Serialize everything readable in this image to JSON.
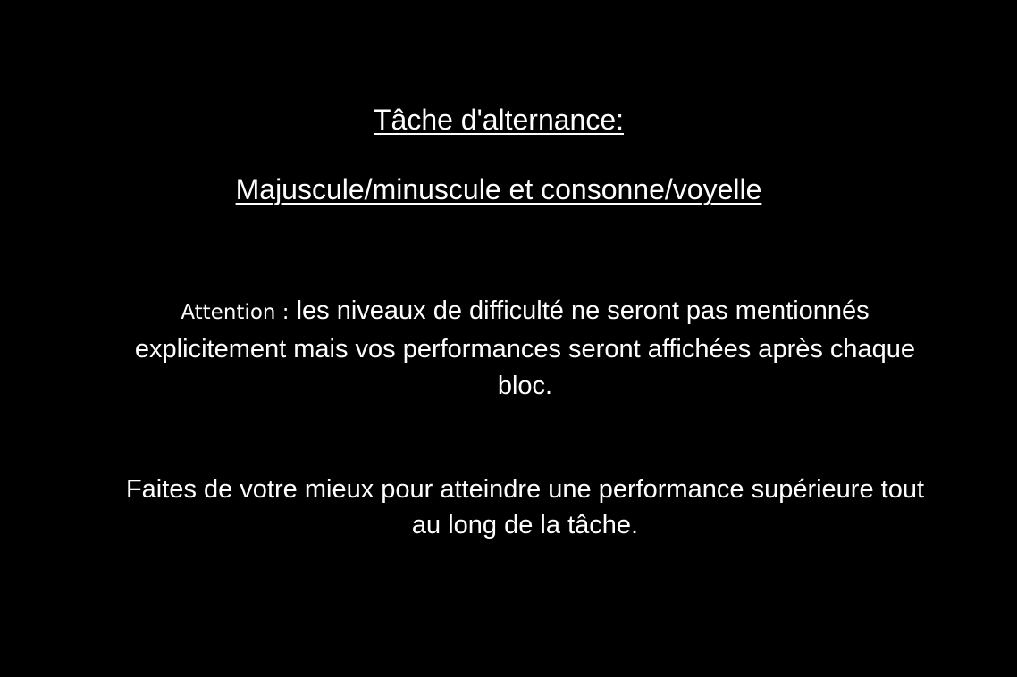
{
  "instructions": {
    "title": "Tâche d'alternance:",
    "subtitle": "Majuscule/minuscule et consonne/voyelle",
    "attention_label": "Attention :",
    "attention_text": " les niveaux de difficulté ne seront pas mentionnés explicitement mais vos performances seront affichées après chaque bloc.",
    "encouragement": "Faites de votre mieux pour atteindre une performance supérieure tout au long de la tâche."
  },
  "colors": {
    "background": "#000000",
    "text": "#ffffff"
  }
}
